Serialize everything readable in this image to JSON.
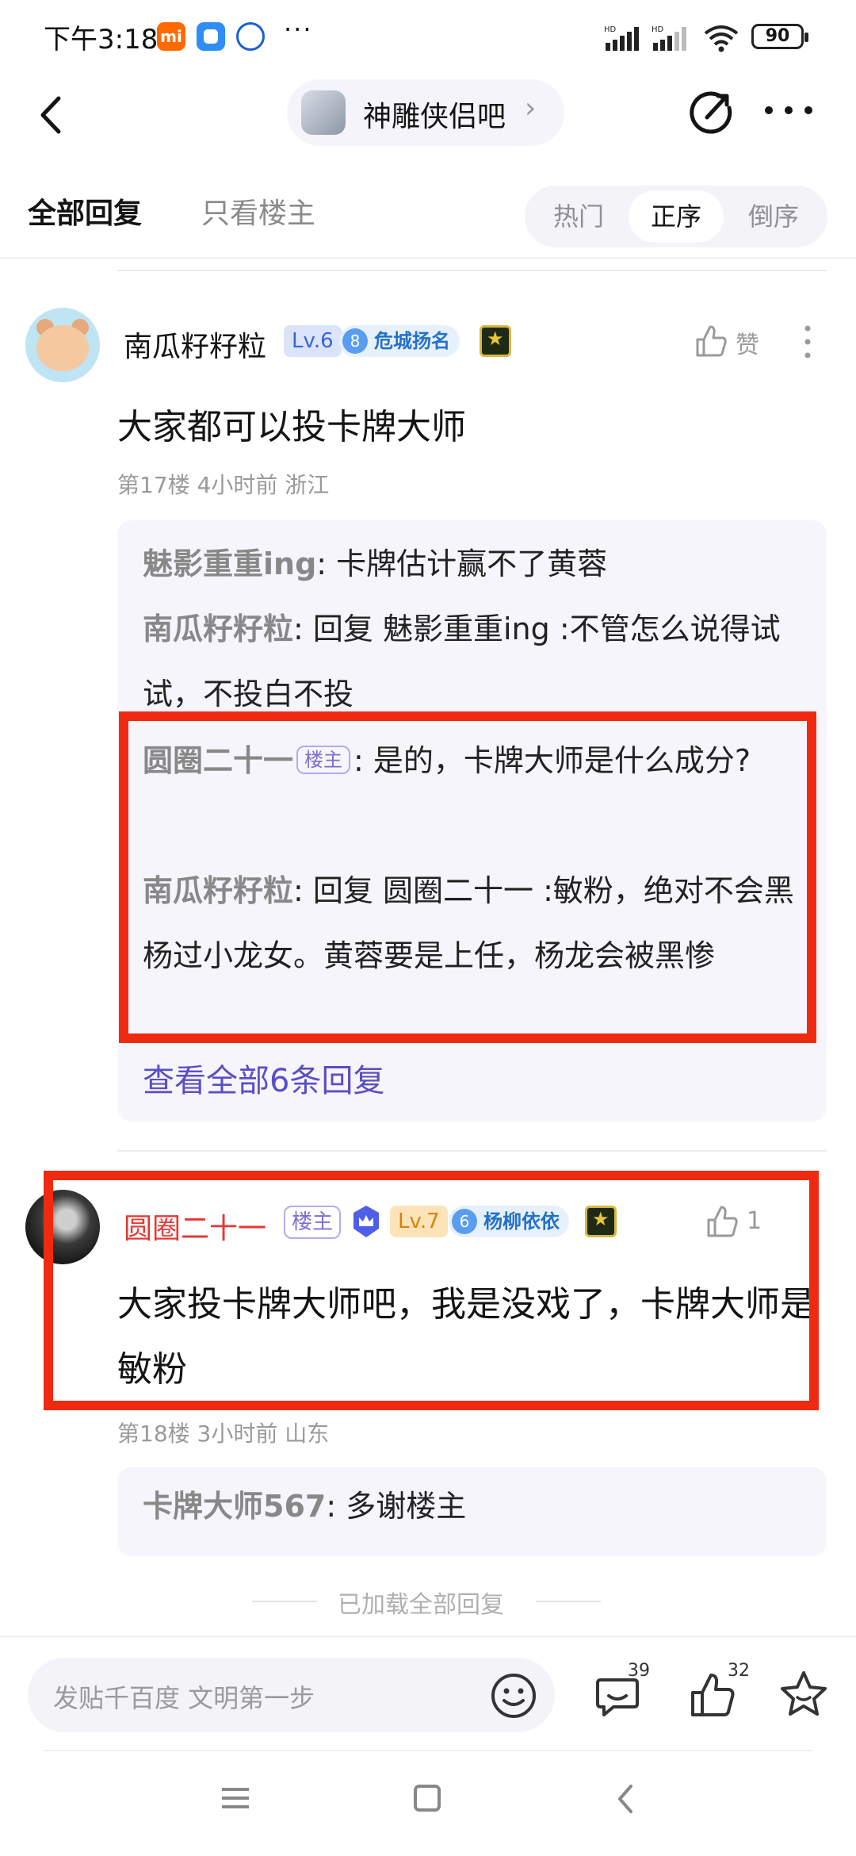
{
  "status_bar": {
    "time": "下午3:18",
    "app_icons": [
      "mi-icon",
      "chat-app-icon",
      "browser-app-icon"
    ],
    "dots": "···",
    "battery": "90"
  },
  "header": {
    "forum_name": "神雕侠侣吧",
    "chevron": "›"
  },
  "tabs": {
    "all_replies": "全部回复",
    "op_only": "只看楼主",
    "sort_options": [
      "热门",
      "正序",
      "倒序"
    ],
    "active_sort": "正序"
  },
  "posts": [
    {
      "username": "南瓜籽籽粒",
      "level": "Lv.6",
      "medal_num": "8",
      "medal_name": "危城扬名",
      "like_label": "赞",
      "content": "大家都可以投卡牌大师",
      "meta": "第17楼   4小时前   浙江",
      "replies": [
        {
          "user": "魅影重重ing",
          "text": "卡牌估计赢不了黄蓉"
        },
        {
          "user": "南瓜籽籽粒",
          "text": "回复 魅影重重ing :不管怎么说得试试，不投白不投"
        },
        {
          "user": "圆圈二十一",
          "op_tag": "楼主",
          "text": "是的，卡牌大师是什么成分?"
        },
        {
          "user": "南瓜籽籽粒",
          "text": "回复 圆圈二十一 :敏粉，绝对不会黑杨过小龙女。黄蓉要是上任，杨龙会被黑惨"
        }
      ],
      "view_all": "查看全部6条回复"
    },
    {
      "username": "圆圈二十一",
      "op_tag": "楼主",
      "level": "Lv.7",
      "medal_num": "6",
      "medal_name": "杨柳依依",
      "like_count": "1",
      "content": "大家投卡牌大师吧，我是没戏了，卡牌大师是敏粉",
      "meta": "第18楼   3小时前   山东",
      "replies": [
        {
          "user": "卡牌大师567",
          "text": "多谢楼主"
        }
      ]
    }
  ],
  "loaded_all": "已加载全部回复",
  "bottom_bar": {
    "input_placeholder": "发贴千百度 文明第一步",
    "comment_count": "39",
    "like_count": "32"
  },
  "colors": {
    "accent_purple": "#5b4ec4",
    "op_red": "#e53935",
    "highlight_red": "#f02a10"
  }
}
